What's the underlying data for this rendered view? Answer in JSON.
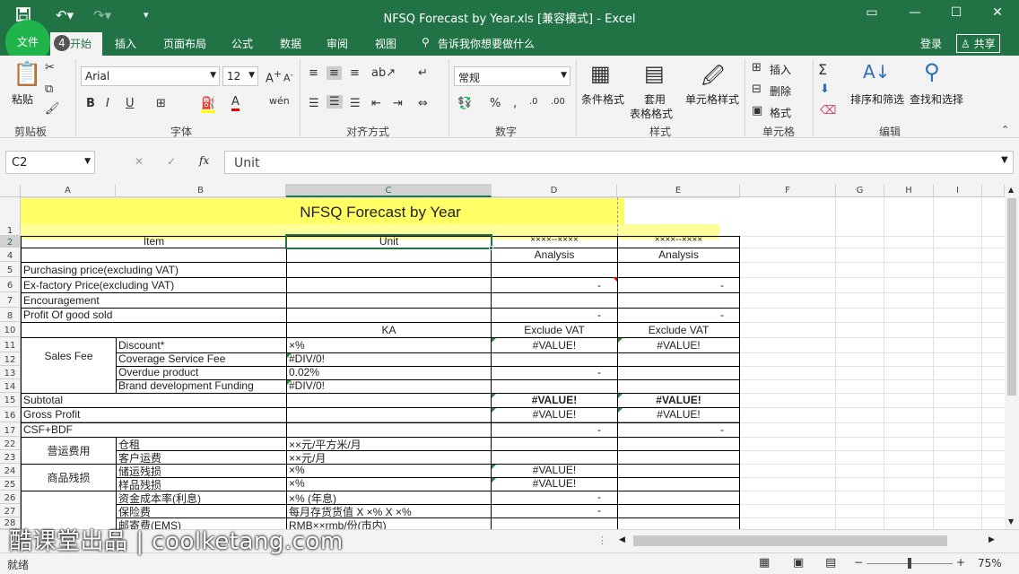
{
  "window": {
    "title": "NFSQ Forecast  by Year.xls  [兼容模式] - Excel",
    "controls": [
      "restore-ribbon",
      "minimize",
      "maximize",
      "close"
    ]
  },
  "tabs": {
    "file": "文件",
    "home_num": "4",
    "home": "开始",
    "items": [
      "插入",
      "页面布局",
      "公式",
      "数据",
      "审阅",
      "视图"
    ],
    "tell_me": "告诉我你想要做什么",
    "login": "登录",
    "share": "共享"
  },
  "ribbon": {
    "clipboard": {
      "paste": "粘贴",
      "label": "剪贴板"
    },
    "font": {
      "name": "Arial",
      "size": "12",
      "label": "字体",
      "bold": "B",
      "italic": "I",
      "underline": "U"
    },
    "align": {
      "label": "对齐方式"
    },
    "number": {
      "format": "常规",
      "percent": "%",
      "label": "数字"
    },
    "styles": {
      "cond": "条件格式",
      "table1": "套用",
      "table2": "表格格式",
      "cell": "单元格样式",
      "label": "样式"
    },
    "cells": {
      "insert": "插入",
      "delete": "删除",
      "format": "格式",
      "label": "单元格"
    },
    "edit": {
      "sort": "排序和筛选",
      "find": "查找和选择",
      "label": "编辑"
    }
  },
  "formula_bar": {
    "name_box": "C2",
    "content": "Unit",
    "fx": "fx"
  },
  "columns": [
    "A",
    "B",
    "C",
    "D",
    "E",
    "F",
    "G",
    "H",
    "I"
  ],
  "rows": [
    "1",
    "2",
    "4",
    "5",
    "6",
    "7",
    "8",
    "10",
    "11",
    "12",
    "13",
    "14",
    "15",
    "16",
    "17",
    "22",
    "23",
    "24",
    "25",
    "26",
    "27",
    "28"
  ],
  "sheet": {
    "title": "NFSQ Forecast  by Year",
    "item": "Item",
    "unit": "Unit",
    "period_d": "××××--××××",
    "period_e": "××××--××××",
    "analysis_d": "Analysis",
    "analysis_e": "Analysis",
    "purchasing": "Purchasing price(excluding VAT)",
    "exfactory": "Ex-factory Price(excluding VAT)",
    "encouragement": "Encouragement",
    "profit": "Profit Of good sold",
    "dash": "-",
    "ka": "KA",
    "exclude_d": "Exclude VAT",
    "exclude_e": "Exclude VAT",
    "sales_fee": "Sales Fee",
    "discount": "Discount*",
    "discount_unit": "×%",
    "value_err": "#VALUE!",
    "coverage": "Coverage Service Fee",
    "div_err": "#DIV/0!",
    "overdue": "Overdue product",
    "overdue_unit": "0.02%",
    "brand": "Brand development Funding",
    "subtotal": "Subtotal",
    "gross": "Gross Profit",
    "csf": "CSF+BDF",
    "ops_fee": "营运费用",
    "warehouse": "仓租",
    "warehouse_unit": "××元/平方米/月",
    "shipping": "客户运费",
    "shipping_unit": "××元/月",
    "goods_loss": "商品残损",
    "storage_loss": "储运残损",
    "storage_unit": "×%",
    "sample_loss": "样品残损",
    "sample_unit": "×%",
    "capital_cost": "资金成本率(利息)",
    "capital_unit": "×% (年息)",
    "insurance": "保险费",
    "insurance_unit": "每月存货货值 X ×% X ×%",
    "postage": "邮寄费(EMS)",
    "postage_unit": "RMB××rmb/份(市内)"
  },
  "status": {
    "ready": "就绪",
    "zoom": "75%"
  },
  "watermark": "酷课堂出品 | coolketang.com",
  "colors": {
    "excel_green": "#217346",
    "highlight": "#ffff66",
    "highlight_pale": "#ffff99"
  }
}
